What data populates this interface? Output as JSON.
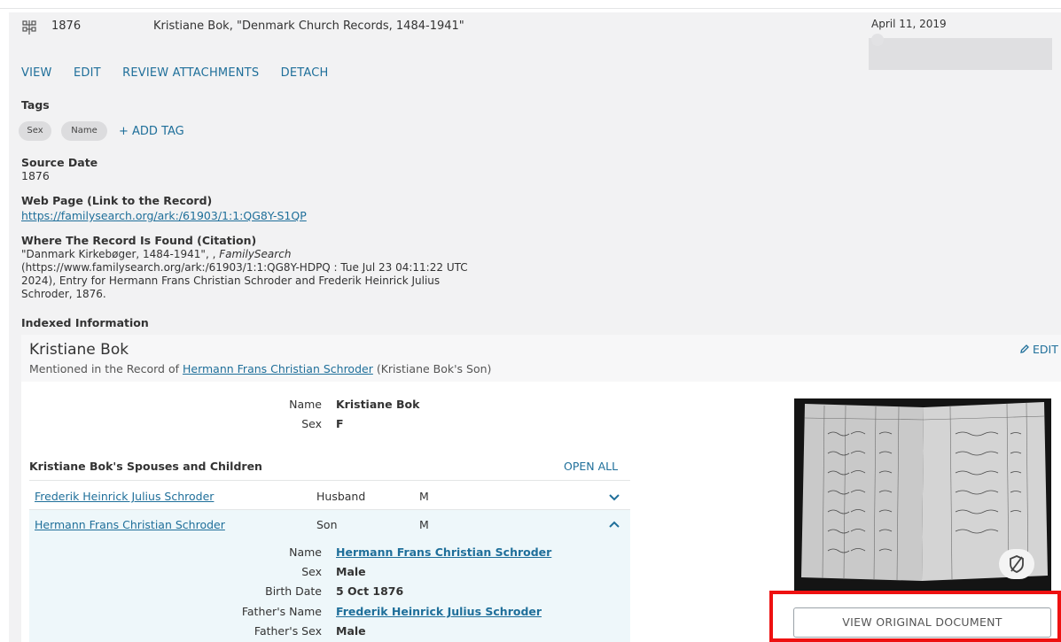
{
  "header": {
    "year": "1876",
    "title": "Kristiane Bok, \"Denmark Church Records, 1484-1941\"",
    "date": "April 11, 2019"
  },
  "actions": [
    "VIEW",
    "EDIT",
    "REVIEW ATTACHMENTS",
    "DETACH"
  ],
  "tags": {
    "label": "Tags",
    "items": [
      "Sex",
      "Name"
    ],
    "add_label": "+ ADD TAG"
  },
  "source_date": {
    "label": "Source Date",
    "value": "1876"
  },
  "web_page": {
    "label": "Web Page (Link to the Record)",
    "url": "https://familysearch.org/ark:/61903/1:1:QG8Y-S1QP"
  },
  "citation": {
    "label": "Where The Record Is Found (Citation)",
    "line1_pre": "\"Danmark Kirkebøger, 1484-1941\", , ",
    "line1_italic": "FamilySearch",
    "line2": "(https://www.familysearch.org/ark:/61903/1:1:QG8Y-HDPQ : Tue Jul 23 04:11:22 UTC",
    "line3": "2024), Entry for Hermann Frans Christian Schroder and Frederik Heinrick Julius",
    "line4": "Schroder, 1876."
  },
  "indexed": {
    "label": "Indexed Information",
    "person": {
      "name": "Kristiane Bok",
      "mention_pre": "Mentioned in the Record of ",
      "mention_link": "Hermann Frans Christian Schroder",
      "mention_post": " (Kristiane Bok's Son)",
      "edit_label": "EDIT"
    },
    "fields": [
      {
        "label": "Name",
        "value": "Kristiane Bok"
      },
      {
        "label": "Sex",
        "value": "F"
      }
    ],
    "spouses_title": "Kristiane Bok's Spouses and Children",
    "open_all": "OPEN ALL",
    "relatives": [
      {
        "name": "Frederik Heinrick Julius Schroder",
        "role": "Husband",
        "sex": "M"
      },
      {
        "name": "Hermann Frans Christian Schroder",
        "role": "Son",
        "sex": "M"
      }
    ],
    "expanded_fields": [
      {
        "label": "Name",
        "value": "Hermann Frans Christian Schroder",
        "link": true
      },
      {
        "label": "Sex",
        "value": "Male",
        "link": false
      },
      {
        "label": "Birth Date",
        "value": "5 Oct 1876",
        "link": false
      },
      {
        "label": "Father's Name",
        "value": "Frederik Heinrick Julius Schroder",
        "link": true
      },
      {
        "label": "Father's Sex",
        "value": "Male",
        "link": false
      }
    ]
  },
  "document": {
    "view_button": "VIEW ORIGINAL DOCUMENT"
  },
  "colors": {
    "link": "#1f6f9a",
    "highlight": "#ee1111",
    "panel": "#f2f2f3"
  }
}
